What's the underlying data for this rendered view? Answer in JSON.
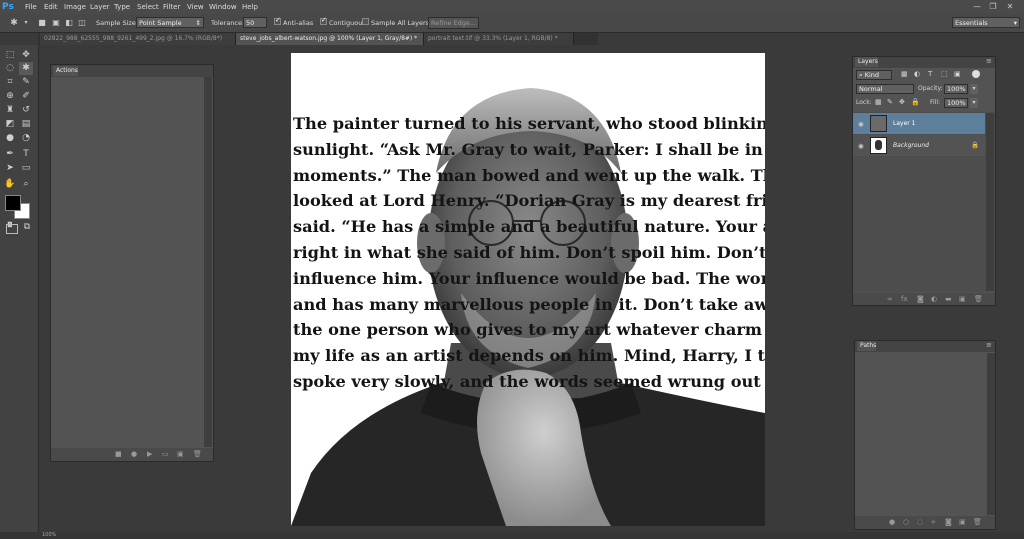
{
  "app": {
    "logo": "Ps"
  },
  "menu": [
    "File",
    "Edit",
    "Image",
    "Layer",
    "Type",
    "Select",
    "Filter",
    "View",
    "Window",
    "Help"
  ],
  "window_controls": [
    "—",
    "❐",
    "✕"
  ],
  "options_bar": {
    "sample_size_label": "Sample Size:",
    "sample_size_value": "Point Sample",
    "tolerance_label": "Tolerance:",
    "tolerance_value": "50",
    "anti_alias": {
      "label": "Anti-alias",
      "checked": true
    },
    "contiguous": {
      "label": "Contiguous",
      "checked": true
    },
    "sample_all_layers": {
      "label": "Sample All Layers",
      "checked": false
    },
    "refine_edge": "Refine Edge...",
    "workspace": "Essentials"
  },
  "tabs": [
    {
      "label": "02822_988_62555_988_9261_499_2.jpg @ 16.7% (RGB/8*)",
      "active": false
    },
    {
      "label": "steve_jobs_albert-watson.jpg @ 100% (Layer 1, Gray/8#) *",
      "active": true
    },
    {
      "label": "portrait text.tif @ 33.3% (Layer 1, RGB/8) *",
      "active": false
    }
  ],
  "actions_panel": {
    "title": "Actions"
  },
  "document_text": [
    "The painter turned to his servant, who stood blinking in the",
    "sunlight. “Ask Mr. Gray to wait, Parker: I shall be in in a few",
    "moments.” The man bowed and went up the walk. Then he",
    "looked at Lord Henry. “Dorian Gray is my dearest friend,” h",
    "said. “He has a simple and a beautiful nature. Your aunt was",
    "right in what she said of him. Don’t spoil him. Don’t try to",
    "influence him. Your influence would be bad. The world is wi",
    "and has many marvellous people in it. Don’t take away from",
    "the one person who gives to my art whatever charm it posse",
    "my life as an artist depends on him. Mind, Harry, I trust you",
    "spoke very slowly, and the words seemed wrung out of him"
  ],
  "layers_panel": {
    "title": "Layers",
    "filter_kind": "Kind",
    "blend_mode": "Normal",
    "opacity_label": "Opacity:",
    "opacity_value": "100%",
    "lock_label": "Lock:",
    "fill_label": "Fill:",
    "fill_value": "100%",
    "layers": [
      {
        "name": "Layer 1",
        "selected": true
      },
      {
        "name": "Background",
        "selected": false
      }
    ]
  },
  "paths_panel": {
    "title": "Paths"
  },
  "status": {
    "zoom": "100%"
  }
}
